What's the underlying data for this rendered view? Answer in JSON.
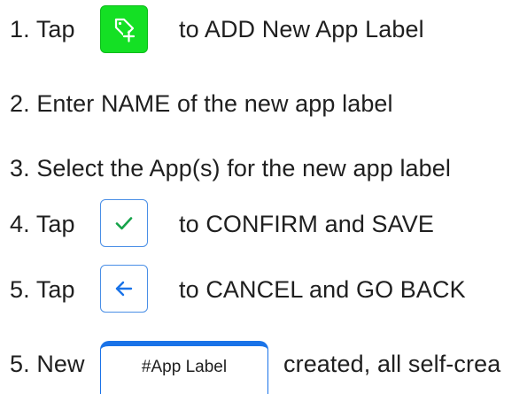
{
  "steps": [
    {
      "prefix": "1. Tap",
      "suffix": "to ADD New App Label"
    },
    {
      "text": "2. Enter NAME of the new app label"
    },
    {
      "text": "3. Select the App(s) for the new app label"
    },
    {
      "prefix": "4. Tap",
      "suffix": "to CONFIRM and SAVE"
    },
    {
      "prefix": "5. Tap",
      "suffix": "to CANCEL and GO BACK"
    },
    {
      "prefix": "5. New",
      "chip_label": "#App Label",
      "suffix": "created, all self-crea"
    }
  ],
  "icons": {
    "add_label": "tag-plus-icon",
    "confirm": "checkmark-icon",
    "cancel": "arrow-left-icon"
  },
  "colors": {
    "add_button": "#14e024",
    "outline_button": "#4a8fe6",
    "checkmark": "#16a34a",
    "back_arrow": "#1a73e8",
    "chip_accent": "#1a73e8"
  }
}
